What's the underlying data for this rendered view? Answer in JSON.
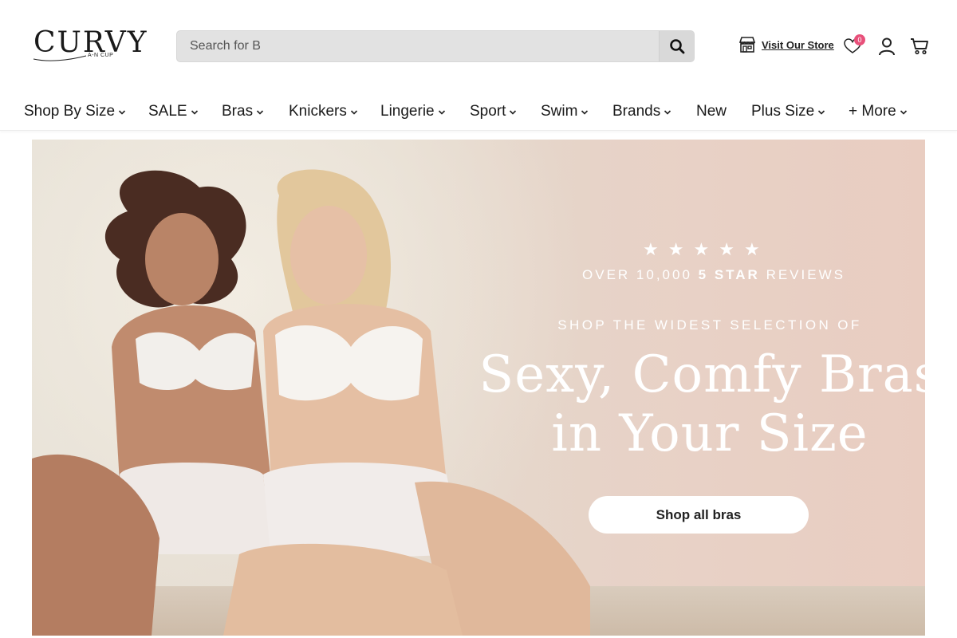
{
  "brand": {
    "wordmark": "CURVY",
    "tagline": "A-N CUP"
  },
  "search": {
    "placeholder": "Search for B",
    "icon": "search-icon"
  },
  "utilities": {
    "store_label": "Visit Our Store",
    "wishlist_count": "0",
    "icons": [
      "store-icon",
      "heart-icon",
      "user-icon",
      "cart-icon"
    ],
    "badge_color": "#e8507a"
  },
  "nav": {
    "items": [
      {
        "label": "Shop By Size",
        "has_menu": true
      },
      {
        "label": "SALE",
        "has_menu": true
      },
      {
        "label": "Bras",
        "has_menu": true
      },
      {
        "label": "Knickers",
        "has_menu": true
      },
      {
        "label": "Lingerie",
        "has_menu": true
      },
      {
        "label": "Sport",
        "has_menu": true
      },
      {
        "label": "Swim",
        "has_menu": true
      },
      {
        "label": "Brands",
        "has_menu": true
      },
      {
        "label": "New",
        "has_menu": false
      },
      {
        "label": "Plus Size",
        "has_menu": true
      },
      {
        "label": "+ More",
        "has_menu": true
      }
    ]
  },
  "hero": {
    "rating_stars": 5,
    "reviews_prefix": "OVER 10,000 ",
    "reviews_highlight": "5 STAR",
    "reviews_suffix": " REVIEWS",
    "kicker": "SHOP THE WIDEST SELECTION OF",
    "headline_line1": "Sexy, Comfy Bras",
    "headline_line2": "in Your Size",
    "cta_label": "Shop all bras"
  }
}
